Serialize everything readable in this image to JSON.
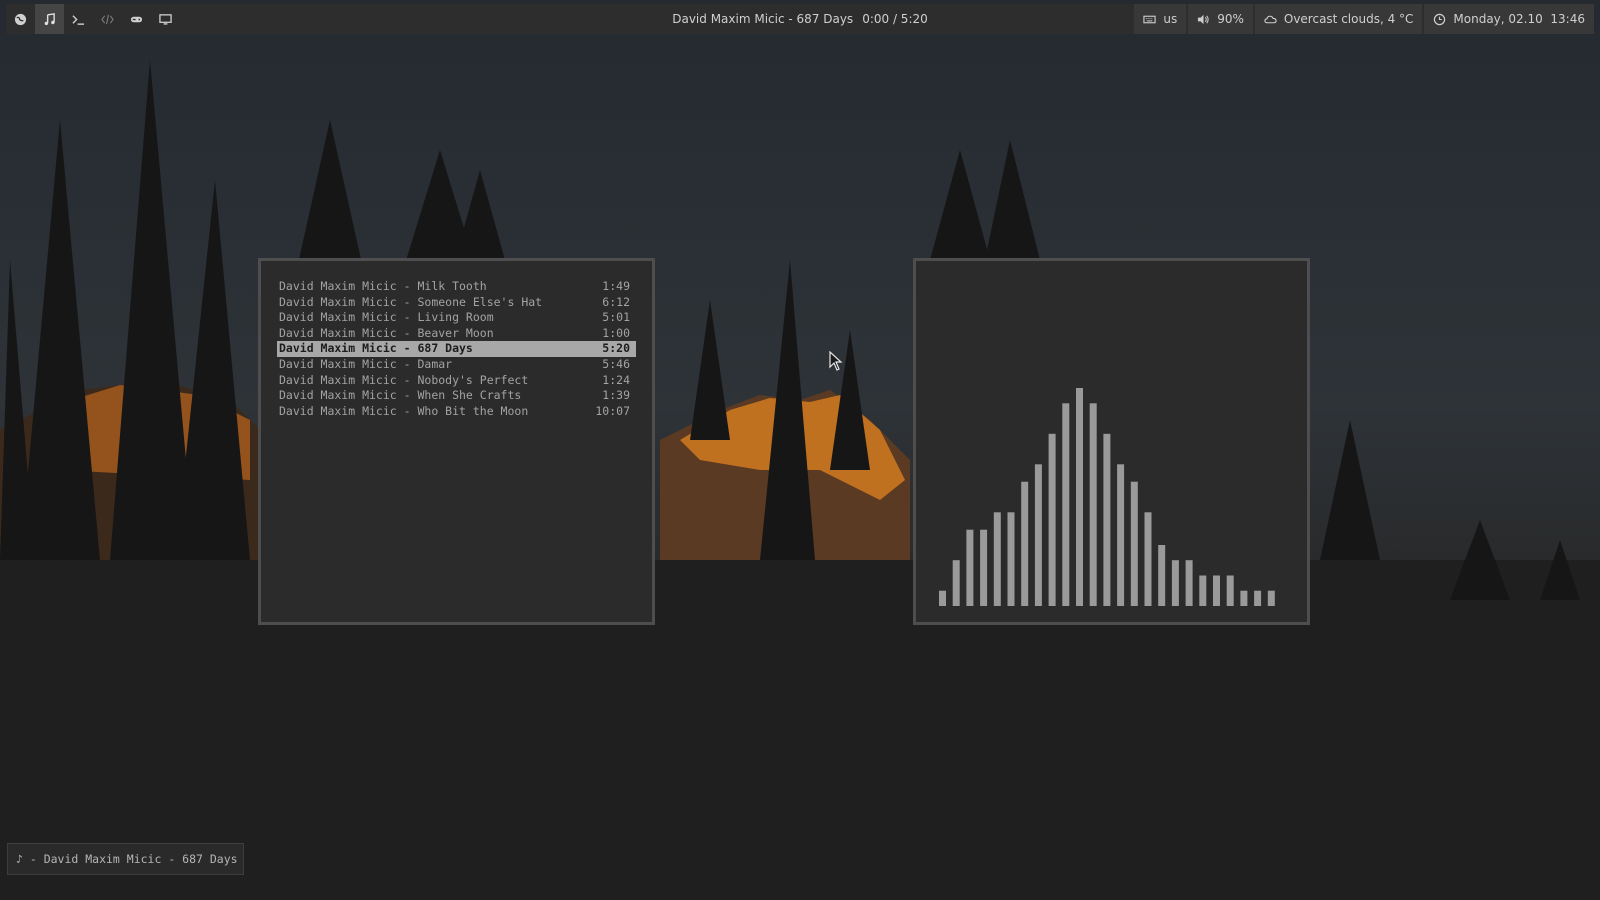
{
  "topbar": {
    "workspaces": [
      {
        "icon": "globe-icon",
        "active": false
      },
      {
        "icon": "music-note-icon",
        "active": true
      },
      {
        "icon": "terminal-prompt-icon",
        "active": false
      },
      {
        "icon": "code-brackets-icon",
        "active": false,
        "dim": true
      },
      {
        "icon": "gamepad-icon",
        "active": false
      },
      {
        "icon": "monitor-icon",
        "active": false
      }
    ],
    "now_playing_title": "David Maxim Micic - 687 Days",
    "now_playing_time": "0:00 / 5:20",
    "keyboard_layout": "us",
    "volume": "90%",
    "weather": "Overcast clouds, 4 °C",
    "date": "Monday, 02.10",
    "time": "13:46"
  },
  "playlist": {
    "selected_index": 4,
    "tracks": [
      {
        "title": "David Maxim Micic - Milk Tooth",
        "duration": "1:49"
      },
      {
        "title": "David Maxim Micic - Someone Else's Hat",
        "duration": "6:12"
      },
      {
        "title": "David Maxim Micic - Living Room",
        "duration": "5:01"
      },
      {
        "title": "David Maxim Micic - Beaver Moon",
        "duration": "1:00"
      },
      {
        "title": "David Maxim Micic - 687 Days",
        "duration": "5:20"
      },
      {
        "title": "David Maxim Micic - Damar",
        "duration": "5:46"
      },
      {
        "title": "David Maxim Micic - Nobody's Perfect",
        "duration": "1:24"
      },
      {
        "title": "David Maxim Micic - When She Crafts",
        "duration": "1:39"
      },
      {
        "title": "David Maxim Micic - Who Bit the Moon",
        "duration": "10:07"
      }
    ]
  },
  "visualizer": {
    "bar_color": "#9a9a9a",
    "levels": [
      0.07,
      0.21,
      0.35,
      0.35,
      0.43,
      0.43,
      0.57,
      0.65,
      0.79,
      0.93,
      1.0,
      0.93,
      0.79,
      0.65,
      0.57,
      0.43,
      0.28,
      0.21,
      0.21,
      0.14,
      0.14,
      0.14,
      0.07,
      0.07,
      0.07
    ]
  },
  "status_line": "♪ - David Maxim Micic - 687 Days",
  "colors": {
    "bar_bg": "#2d2d2d",
    "module_bg": "#383838",
    "text": "#cfcfcf",
    "selection_bg": "#a8a8a8"
  }
}
